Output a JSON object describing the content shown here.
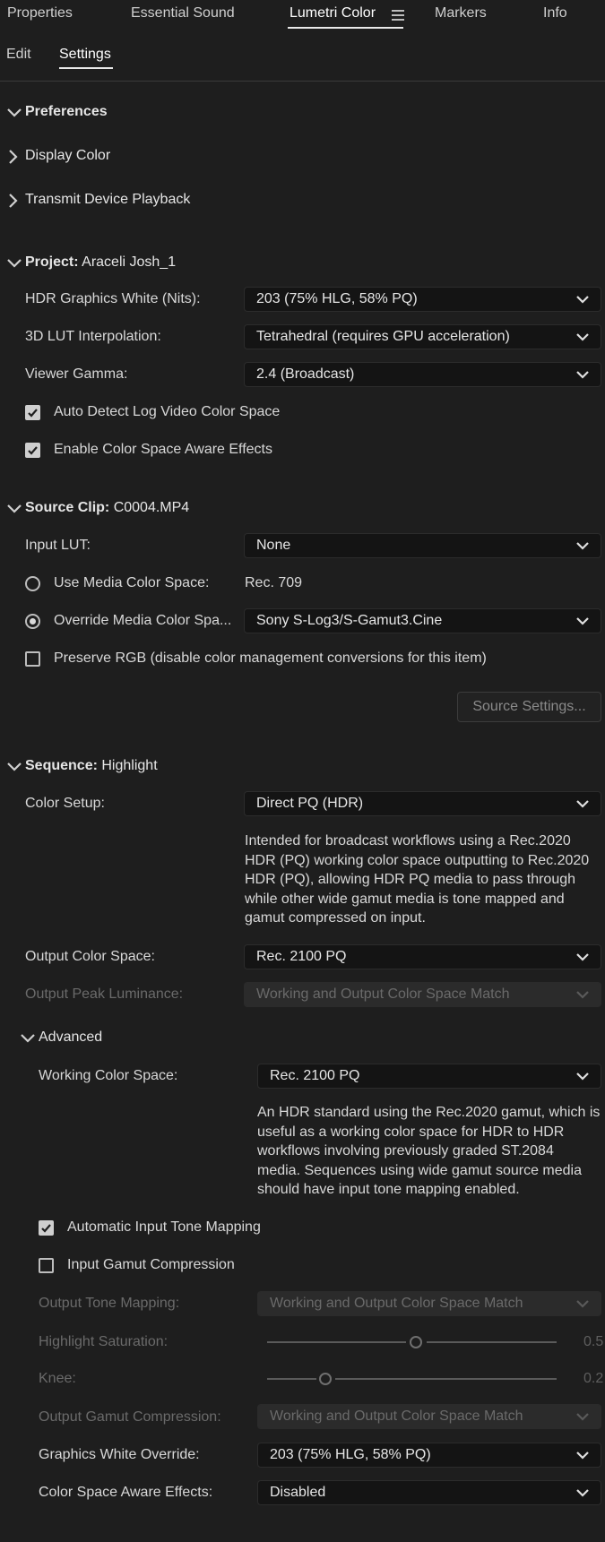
{
  "tabs": [
    "Properties",
    "Essential Sound",
    "Lumetri Color",
    "Markers",
    "Info"
  ],
  "subtabs": [
    "Edit",
    "Settings"
  ],
  "preferences": {
    "title": "Preferences",
    "items": [
      "Display Color",
      "Transmit Device Playback"
    ]
  },
  "project": {
    "title_bold": "Project:",
    "title_name": "Araceli Josh_1",
    "hdr_white_label": "HDR Graphics White (Nits):",
    "hdr_white_value": "203 (75% HLG, 58% PQ)",
    "lut_interp_label": "3D LUT Interpolation:",
    "lut_interp_value": "Tetrahedral (requires GPU acceleration)",
    "gamma_label": "Viewer Gamma:",
    "gamma_value": "2.4 (Broadcast)",
    "auto_detect_label": "Auto Detect Log Video Color Space",
    "auto_detect_checked": true,
    "enable_csae_label": "Enable Color Space Aware Effects",
    "enable_csae_checked": true
  },
  "source_clip": {
    "title_bold": "Source Clip:",
    "title_name": "C0004.MP4",
    "input_lut_label": "Input LUT:",
    "input_lut_value": "None",
    "use_media_label": "Use Media Color Space:",
    "use_media_value": "Rec. 709",
    "override_label": "Override Media Color Spa...",
    "override_value": "Sony S-Log3/S-Gamut3.Cine",
    "override_selected": true,
    "preserve_rgb_label": "Preserve RGB (disable color management conversions for this item)",
    "preserve_rgb_checked": false,
    "source_settings_button": "Source Settings..."
  },
  "sequence": {
    "title_bold": "Sequence:",
    "title_name": "Highlight",
    "color_setup_label": "Color Setup:",
    "color_setup_value": "Direct PQ (HDR)",
    "color_setup_desc": [
      "Intended for broadcast workflows using a Rec.2020",
      "HDR (PQ) working color space outputting to Rec.2020",
      "HDR (PQ), allowing HDR PQ media to pass through",
      "while other wide gamut media is tone mapped and",
      "gamut compressed on input."
    ],
    "output_cs_label": "Output Color Space:",
    "output_cs_value": "Rec. 2100 PQ",
    "output_peak_label": "Output Peak Luminance:",
    "output_peak_value": "Working and Output Color Space Match",
    "advanced": {
      "title": "Advanced",
      "working_cs_label": "Working Color Space:",
      "working_cs_value": "Rec. 2100 PQ",
      "working_cs_desc": [
        "An HDR standard using the Rec.2020 gamut, which is",
        "useful as a working color space for HDR to HDR",
        "workflows involving previously graded ST.2084",
        "media. Sequences using wide gamut source media",
        "should have input tone mapping enabled."
      ],
      "auto_tone_label": "Automatic Input Tone Mapping",
      "auto_tone_checked": true,
      "gamut_comp_label": "Input Gamut Compression",
      "gamut_comp_checked": false,
      "out_tone_label": "Output Tone Mapping:",
      "out_tone_value": "Working and Output Color Space Match",
      "highlight_sat_label": "Highlight Saturation:",
      "highlight_sat_value": "0.5",
      "knee_label": "Knee:",
      "knee_value": "0.2",
      "out_gamut_label": "Output Gamut Compression:",
      "out_gamut_value": "Working and Output Color Space Match",
      "gfx_white_label": "Graphics White Override:",
      "gfx_white_value": "203 (75% HLG, 58% PQ)",
      "csae_label": "Color Space Aware Effects:",
      "csae_value": "Disabled"
    }
  }
}
